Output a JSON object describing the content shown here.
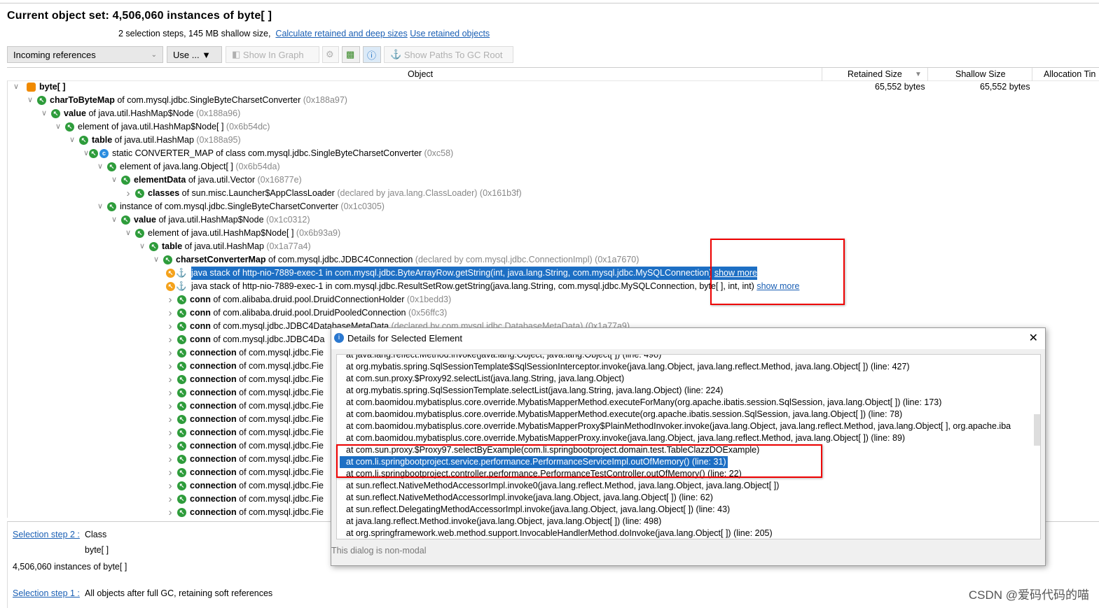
{
  "header": {
    "title": "Current object set:  4,506,060 instances of byte[ ]",
    "summary": "2 selection steps, 145 MB shallow size,",
    "calc_link": "Calculate retained and deep sizes",
    "use_retained_link": "Use retained objects"
  },
  "toolbar": {
    "view_select": "Incoming references",
    "use_button": "Use ... ▼",
    "show_in_graph": "Show In Graph",
    "show_paths": "Show Paths To GC Root"
  },
  "columns": {
    "object": "Object",
    "retained": "Retained Size",
    "shallow": "Shallow Size",
    "allocation": "Allocation Tin"
  },
  "tree": [
    {
      "level": 0,
      "exp": "open",
      "icon": "array",
      "name": "byte[ ]",
      "rest": "",
      "gray": "",
      "retained": "65,552 bytes",
      "shallow": "65,552 bytes"
    },
    {
      "level": 1,
      "exp": "open",
      "icon": "ref",
      "name": "charToByteMap",
      "rest": " of com.mysql.jdbc.SingleByteCharsetConverter ",
      "gray": "(0x188a97)"
    },
    {
      "level": 2,
      "exp": "open",
      "icon": "ref",
      "name": "value",
      "rest": " of java.util.HashMap$Node ",
      "gray": "(0x188a96)"
    },
    {
      "level": 3,
      "exp": "open",
      "icon": "ref",
      "name": "",
      "rest": "element of java.util.HashMap$Node[ ] ",
      "gray": "(0x6b54dc)"
    },
    {
      "level": 4,
      "exp": "open",
      "icon": "ref",
      "name": "table",
      "rest": " of java.util.HashMap ",
      "gray": "(0x188a95)"
    },
    {
      "level": 5,
      "exp": "open",
      "icon": "static",
      "name": "",
      "rest": "static CONVERTER_MAP of class com.mysql.jdbc.SingleByteCharsetConverter ",
      "gray": "(0xc58)"
    },
    {
      "level": 6,
      "exp": "open",
      "icon": "ref",
      "name": "",
      "rest": "element of java.lang.Object[ ] ",
      "gray": "(0x6b54da)"
    },
    {
      "level": 7,
      "exp": "open",
      "icon": "ref",
      "name": "elementData",
      "rest": " of java.util.Vector ",
      "gray": "(0x16877e)"
    },
    {
      "level": 8,
      "exp": "closed",
      "icon": "ref",
      "name": "classes",
      "rest": " of sun.misc.Launcher$AppClassLoader ",
      "gray": "(declared by java.lang.ClassLoader) (0x161b3f)"
    },
    {
      "level": 6,
      "exp": "open",
      "icon": "ref",
      "name": "",
      "rest": "instance of com.mysql.jdbc.SingleByteCharsetConverter ",
      "gray": "(0x1c0305)"
    },
    {
      "level": 7,
      "exp": "open",
      "icon": "ref",
      "name": "value",
      "rest": " of java.util.HashMap$Node ",
      "gray": "(0x1c0312)"
    },
    {
      "level": 8,
      "exp": "open",
      "icon": "ref",
      "name": "",
      "rest": "element of java.util.HashMap$Node[ ] ",
      "gray": "(0x6b93a9)"
    },
    {
      "level": 9,
      "exp": "open",
      "icon": "ref",
      "name": "table",
      "rest": " of java.util.HashMap ",
      "gray": "(0x1a77a4)"
    },
    {
      "level": 10,
      "exp": "open",
      "icon": "ref",
      "name": "charsetConverterMap",
      "rest": " of com.mysql.jdbc.JDBC4Connection ",
      "gray": "(declared by com.mysql.jdbc.ConnectionImpl) (0x1a7670)"
    },
    {
      "level": 11,
      "exp": "",
      "icon": "stack",
      "name": "",
      "rest": "java stack of http-nio-7889-exec-1 in com.mysql.jdbc.ByteArrayRow.getString(int, java.lang.String, com.mysql.jdbc.MySQLConnection) ",
      "gray": "",
      "link": "show more",
      "selected": true
    },
    {
      "level": 11,
      "exp": "",
      "icon": "stack",
      "name": "",
      "rest": "java stack of http-nio-7889-exec-1 in com.mysql.jdbc.ResultSetRow.getString(java.lang.String, com.mysql.jdbc.MySQLConnection, byte[ ], int, int) ",
      "gray": "",
      "link": "show more"
    },
    {
      "level": 11,
      "exp": "closed",
      "icon": "ref",
      "name": "conn",
      "rest": " of com.alibaba.druid.pool.DruidConnectionHolder ",
      "gray": "(0x1bedd3)"
    },
    {
      "level": 11,
      "exp": "closed",
      "icon": "ref",
      "name": "conn",
      "rest": " of com.alibaba.druid.pool.DruidPooledConnection ",
      "gray": "(0x56ffc3)"
    },
    {
      "level": 11,
      "exp": "closed",
      "icon": "ref",
      "name": "conn",
      "rest": " of com.mysql.jdbc.JDBC4DatabaseMetaData ",
      "gray": "(declared by com.mysql.jdbc.DatabaseMetaData) (0x1a77a9)"
    },
    {
      "level": 11,
      "exp": "closed",
      "icon": "ref",
      "name": "conn",
      "rest": " of com.mysql.jdbc.JDBC4Da",
      "gray": ""
    },
    {
      "level": 11,
      "exp": "closed",
      "icon": "ref",
      "name": "connection",
      "rest": " of com.mysql.jdbc.Fie",
      "gray": ""
    },
    {
      "level": 11,
      "exp": "closed",
      "icon": "ref",
      "name": "connection",
      "rest": " of com.mysql.jdbc.Fie",
      "gray": ""
    },
    {
      "level": 11,
      "exp": "closed",
      "icon": "ref",
      "name": "connection",
      "rest": " of com.mysql.jdbc.Fie",
      "gray": ""
    },
    {
      "level": 11,
      "exp": "closed",
      "icon": "ref",
      "name": "connection",
      "rest": " of com.mysql.jdbc.Fie",
      "gray": ""
    },
    {
      "level": 11,
      "exp": "closed",
      "icon": "ref",
      "name": "connection",
      "rest": " of com.mysql.jdbc.Fie",
      "gray": ""
    },
    {
      "level": 11,
      "exp": "closed",
      "icon": "ref",
      "name": "connection",
      "rest": " of com.mysql.jdbc.Fie",
      "gray": ""
    },
    {
      "level": 11,
      "exp": "closed",
      "icon": "ref",
      "name": "connection",
      "rest": " of com.mysql.jdbc.Fie",
      "gray": ""
    },
    {
      "level": 11,
      "exp": "closed",
      "icon": "ref",
      "name": "connection",
      "rest": " of com.mysql.jdbc.Fie",
      "gray": ""
    },
    {
      "level": 11,
      "exp": "closed",
      "icon": "ref",
      "name": "connection",
      "rest": " of com.mysql.jdbc.Fie",
      "gray": ""
    },
    {
      "level": 11,
      "exp": "closed",
      "icon": "ref",
      "name": "connection",
      "rest": " of com.mysql.jdbc.Fie",
      "gray": ""
    },
    {
      "level": 11,
      "exp": "closed",
      "icon": "ref",
      "name": "connection",
      "rest": " of com.mysql.jdbc.Fie",
      "gray": ""
    },
    {
      "level": 11,
      "exp": "closed",
      "icon": "ref",
      "name": "connection",
      "rest": " of com.mysql.jdbc.Fie",
      "gray": ""
    },
    {
      "level": 11,
      "exp": "closed",
      "icon": "ref",
      "name": "connection",
      "rest": " of com.mysql.jdbc.Fie",
      "gray": ""
    }
  ],
  "bottom": {
    "step2_link": "Selection step 2 :",
    "step2_text": "Class",
    "step2_class": "byte[ ]",
    "step2_count": "4,506,060 instances of byte[ ]",
    "step1_link": "Selection step 1 :",
    "step1_text": "All objects after full GC, retaining soft references"
  },
  "dialog": {
    "title": "Details for Selected Element",
    "footer": "This dialog is non-modal",
    "lines": [
      "at java.lang.reflect.Method.invoke(java.lang.Object, java.lang.Object[ ]) (line: 498)",
      "at org.mybatis.spring.SqlSessionTemplate$SqlSessionInterceptor.invoke(java.lang.Object, java.lang.reflect.Method, java.lang.Object[ ]) (line: 427)",
      "at com.sun.proxy.$Proxy92.selectList(java.lang.String, java.lang.Object)",
      "at org.mybatis.spring.SqlSessionTemplate.selectList(java.lang.String, java.lang.Object) (line: 224)",
      "at com.baomidou.mybatisplus.core.override.MybatisMapperMethod.executeForMany(org.apache.ibatis.session.SqlSession, java.lang.Object[ ]) (line: 173)",
      "at com.baomidou.mybatisplus.core.override.MybatisMapperMethod.execute(org.apache.ibatis.session.SqlSession, java.lang.Object[ ]) (line: 78)",
      "at com.baomidou.mybatisplus.core.override.MybatisMapperProxy$PlainMethodInvoker.invoke(java.lang.Object, java.lang.reflect.Method, java.lang.Object[ ], org.apache.iba",
      "at com.baomidou.mybatisplus.core.override.MybatisMapperProxy.invoke(java.lang.Object, java.lang.reflect.Method, java.lang.Object[ ]) (line: 89)",
      "at com.sun.proxy.$Proxy97.selectByExample(com.li.springbootproject.domain.test.TableClazzDOExample)",
      "at com.li.springbootproject.service.performance.PerformanceServiceImpl.outOfMemory() (line: 31)",
      "at com.li.springbootproject.controller.performance.PerformanceTestController.outOfMemory() (line: 22)",
      "at sun.reflect.NativeMethodAccessorImpl.invoke0(java.lang.reflect.Method, java.lang.Object, java.lang.Object[ ])",
      "at sun.reflect.NativeMethodAccessorImpl.invoke(java.lang.Object, java.lang.Object[ ]) (line: 62)",
      "at sun.reflect.DelegatingMethodAccessorImpl.invoke(java.lang.Object, java.lang.Object[ ]) (line: 43)",
      "at java.lang.reflect.Method.invoke(java.lang.Object, java.lang.Object[ ]) (line: 498)",
      "at org.springframework.web.method.support.InvocableHandlerMethod.doInvoke(java.lang.Object[ ]) (line: 205)"
    ],
    "selected_line": 9
  },
  "watermark": "CSDN @爱码代码的喵",
  "colors": {
    "selection": "#1d6fc4",
    "link": "#1a5fb4",
    "highlight_box": "#e00000",
    "ref_icon": "#2e9c3b",
    "array_icon": "#f08a00"
  }
}
